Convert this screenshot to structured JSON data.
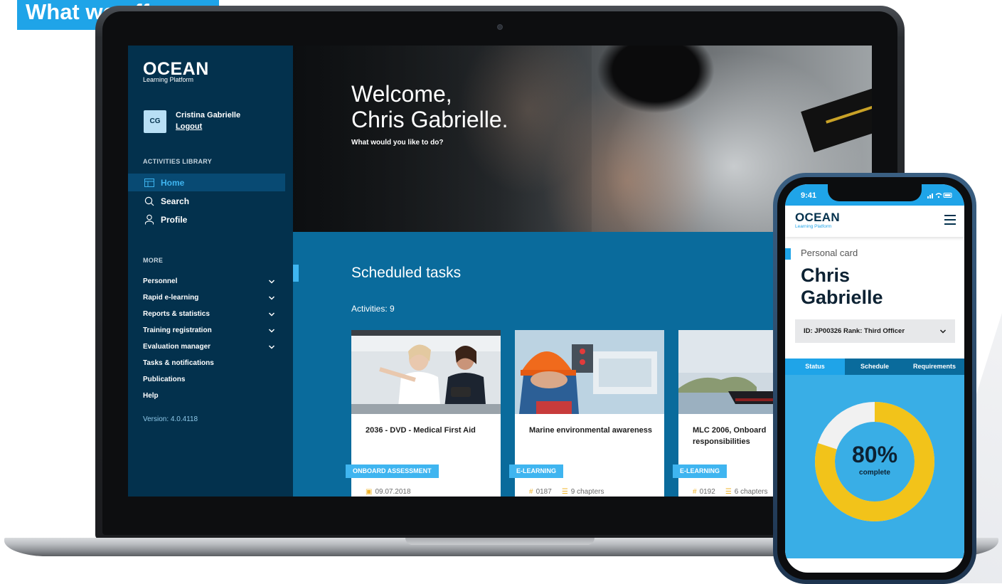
{
  "badge": {
    "label": "What we offer"
  },
  "app": {
    "logo": "OCEAN",
    "logo_sub": "Learning Platform",
    "user": {
      "initials": "CG",
      "name": "Cristina Gabrielle",
      "logout": "Logout"
    },
    "library_label": "ACTIVITIES LIBRARY",
    "nav": [
      {
        "label": "Home",
        "icon": "home-icon",
        "active": true
      },
      {
        "label": "Search",
        "icon": "search-icon",
        "active": false
      },
      {
        "label": "Profile",
        "icon": "profile-icon",
        "active": false
      }
    ],
    "more_label": "MORE",
    "more": [
      {
        "label": "Personnel",
        "expandable": true
      },
      {
        "label": "Rapid e-learning",
        "expandable": true
      },
      {
        "label": "Reports & statistics",
        "expandable": true
      },
      {
        "label": "Training registration",
        "expandable": true
      },
      {
        "label": "Evaluation manager",
        "expandable": true
      },
      {
        "label": "Tasks & notifications",
        "expandable": false
      },
      {
        "label": "Publications",
        "expandable": false
      },
      {
        "label": "Help",
        "expandable": false
      }
    ],
    "version": "Version: 4.0.4118",
    "hero": {
      "title_line1": "Welcome,",
      "title_line2": "Chris Gabrielle.",
      "subtitle": "What would you like to do?"
    },
    "scheduled": {
      "title": "Scheduled tasks",
      "activities": "Activities: 9",
      "cards": [
        {
          "title": "2036 - DVD - Medical First Aid",
          "tag": "ONBOARD ASSESSMENT",
          "meta": [
            "09.07.2018"
          ]
        },
        {
          "title": "Marine environmental awareness",
          "tag": "E-LEARNING",
          "meta": [
            "0187",
            "9 chapters"
          ]
        },
        {
          "title": "MLC 2006, Onboard responsibilities",
          "tag": "E-LEARNING",
          "meta": [
            "0192",
            "6 chapters"
          ]
        }
      ]
    }
  },
  "phone": {
    "time": "9:41",
    "logo": "OCEAN",
    "logo_sub": "Learning Platform",
    "card_label": "Personal card",
    "name_line1": "Chris",
    "name_line2": "Gabrielle",
    "select_value": "ID: JP00326 Rank: Third Officer",
    "tabs": [
      "Status",
      "Schedule",
      "Requirements"
    ],
    "progress": {
      "value": 80,
      "percent_label": "80%",
      "caption": "complete"
    }
  },
  "colors": {
    "brand_blue": "#1fa4e8",
    "navy": "#03314d",
    "panel_blue": "#0a6b9c",
    "donut_fill": "#f2c31a",
    "donut_track": "#f1f1f1"
  }
}
